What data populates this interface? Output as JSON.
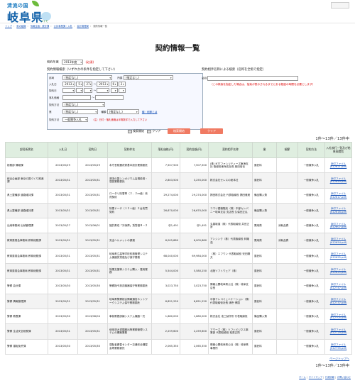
{
  "header": {
    "logo_sub": "清流の国",
    "logo_main": "岐阜県",
    "mascot_label": "ミナモ"
  },
  "breadcrumb": [
    "トップ",
    "県の組織",
    "情報企画・統計課",
    "公共事業課・入札",
    "会計管理局",
    "契約情報一覧"
  ],
  "page_title": "契約情報一覧",
  "year_filter": {
    "label": "契約年度",
    "value": "2013年度",
    "required": "(必須)"
  },
  "search_by_info": {
    "caption": "契約情報検索（いずれかの条件を指定して下さい）",
    "fields": {
      "bureau": {
        "label": "部局",
        "value": "(指定なし)"
      },
      "office": {
        "label": "所属",
        "value": "(指定なし)"
      },
      "bid_date": {
        "label": "入札日",
        "y1": "2013",
        "m1": "5",
        "d1": "27",
        "y2": "2013",
        "m2": "6",
        "d2": "2"
      },
      "contract_date": {
        "label": "契約日"
      },
      "amount": {
        "label": "落札価格"
      },
      "method": {
        "label": "契約方法",
        "value": "(指定なし)"
      },
      "type": {
        "label": "業",
        "value": "(指定なし)",
        "kind_label": "種類",
        "kind_value": "(指定なし)",
        "link": "種・細節とは"
      },
      "contract_type": {
        "label": "契約方法",
        "value": "一般競争入札"
      }
    },
    "note": "（注）日付・落札価格は半角数字で入力して下さい"
  },
  "search_by_keyword": {
    "caption": "契約相手名称による検索（名称を全角で指定）",
    "field_label": "名称",
    "note": "（この検索を指定した場合は、指索が表示されるまでにある程度の時間を必要とします）"
  },
  "buttons": {
    "print_label": "検索開始",
    "clear_label": "クリア",
    "search": "検索開始",
    "clear": "クリア"
  },
  "result_count": "1件～13件／13件中",
  "table": {
    "headers": [
      "部局所属名",
      "入札日",
      "契約日",
      "契約件名",
      "落札価格(円)",
      "契約金額(円)",
      "契約相手名称",
      "業",
      "細節",
      "契約方法",
      "入札執行一覧及び結果表閲覧"
    ],
    "rows": [
      [
        "総務部 情報課",
        "2013/05/29",
        "2013/05/29",
        "本庁舎耐震改修基本設計業務委託",
        "7,507,500",
        "7,507,500",
        "(株) NTTファシリティーズ東海支社 取締役東海支社長 奥田信也",
        "委託料",
        "",
        "一般競争入札",
        "添付ファイル (K12621.pdf)"
      ],
      [
        "総合企画部 東京の国づくり推進課",
        "2013/05/31",
        "2013/05/31",
        "清流の国シンポジウム会場設営・運営業務委託",
        "2,803,500",
        "3,255,000",
        "株式会社セレスの総本社",
        "委託料",
        "",
        "一般競争入札",
        "添付ファイル (K12649.pdf)"
      ],
      [
        "県土整備部 道路維持課",
        "2013/05/31",
        "2013/05/31",
        "ロータリ除雪車（２．２ｍ級）売買契約",
        "29,274,000",
        "29,274,000",
        "揖田株式会社 代表取締役 揖田雅美",
        "備品購入費",
        "",
        "一般競争入札",
        "添付ファイル (K12617.pdf)"
      ],
      [
        "県土整備部 道路維持課",
        "2013/05/31",
        "2013/05/31",
        "除雪ドーザ（１２ｔ級）２台売買契約",
        "26,670,000",
        "26,670,000",
        "コマツ建機販売（株）中部カンパニー岐阜支店 支店長 久保田正弘",
        "備品購入費",
        "",
        "一般競争入札",
        "添付ファイル (K12616.pdf)"
      ],
      [
        "出納事務局 出納管理課",
        "2013/05/27",
        "2013/06/01",
        "福井県収「冷凍庫」賃貸借Ｂ－２",
        "@1,491",
        "@1,491",
        "丸善雄運（株）代表取締役 井田正彦",
        "需用費",
        "消耗品費",
        "一般競争入札",
        "添付ファイル (K12607.pdf)"
      ],
      [
        "教育委員会事務局 教育総務課",
        "2013/05/31",
        "2013/05/31",
        "安全ヘルメットの調達",
        "6,005,880",
        "6,005,880",
        "アンシンク（株）代表取締役 林隆浩",
        "需用費",
        "消耗品費",
        "一般競争入札",
        "添付ファイル (K12654.pdf)"
      ],
      [
        "教育委員会事務局 教育総務課",
        "2013/05/31",
        "2013/05/31",
        "岐阜県立高等学校校務管理システム機器賃貸借及び保守業務",
        "68,040,000",
        "69,984,000",
        "（株）エフウン 代表取締役 安田陽夫",
        "委託料",
        "",
        "一般競争入札",
        "添付ファイル (K12655.pdf)"
      ],
      [
        "教育委員会事務局 教育総務課",
        "2013/05/31",
        "2013/05/31",
        "授業支援等システム購入・運用業務",
        "5,544,000",
        "5,580,250",
        "北陸ソフトウェア（株）",
        "委託料",
        "",
        "一般競争入札",
        "添付ファイル (K12625.pdf)"
      ],
      [
        "警察 会計課",
        "2013/05/30",
        "2013/05/30",
        "警察指令放送機器保守等業務委託",
        "3,023,750",
        "3,023,750",
        "情報公開岐阜県公社（株）岐阜支店長",
        "委託料",
        "",
        "一般競争入札",
        "添付ファイル (K12747.pdf)"
      ],
      [
        "警察 情報管理課",
        "2013/05/31",
        "2013/05/31",
        "岐阜県警察総合情報通信ネットワークシステム保守業務委託",
        "6,851,250",
        "6,851,250",
        "中部テレコミュニケーション（株）代表取締役社長 浦壱 博国",
        "委託料",
        "",
        "一般競争入札",
        "添付ファイル (K12737.pdf)"
      ],
      [
        "警察 教養課",
        "2013/05/30",
        "2013/06/04",
        "事前教養訓練システム機器一式",
        "1,680,000",
        "1,680,000",
        "株式会社 池三製作所 代表取締役",
        "備品購入費",
        "",
        "一般競争入札",
        "添付ファイル (K12705.pdf)"
      ],
      [
        "警察 生活安全総務課",
        "2013/05/31",
        "2013/05/31",
        "使用済み書類搬出等業務管理システムの構築業務",
        "2,259,600",
        "2,259,600",
        "アウーズ（株）ソフトビジネス事業部 代表取締役 松原正則",
        "委託料",
        "",
        "一般競争入札",
        "添付ファイル (K12729.pdf)"
      ],
      [
        "警察 運転免許課",
        "2013/05/30",
        "2013/05/30",
        "運転者講習センター交通安全講習会等業務委託",
        "2,065,350",
        "2,065,350",
        "情報公開岐阜県公社（株）岐阜県事業所",
        "委託料",
        "",
        "一般競争入札",
        "添付ファイル (K12755.pdf)"
      ]
    ]
  },
  "page_top_label": "ページトップへ",
  "footer_links": [
    "ホーム",
    "サイトマップ",
    "行政情報",
    "お問い合わせ"
  ],
  "footer_right": "当サイトについて | 個人情報の取り扱い"
}
